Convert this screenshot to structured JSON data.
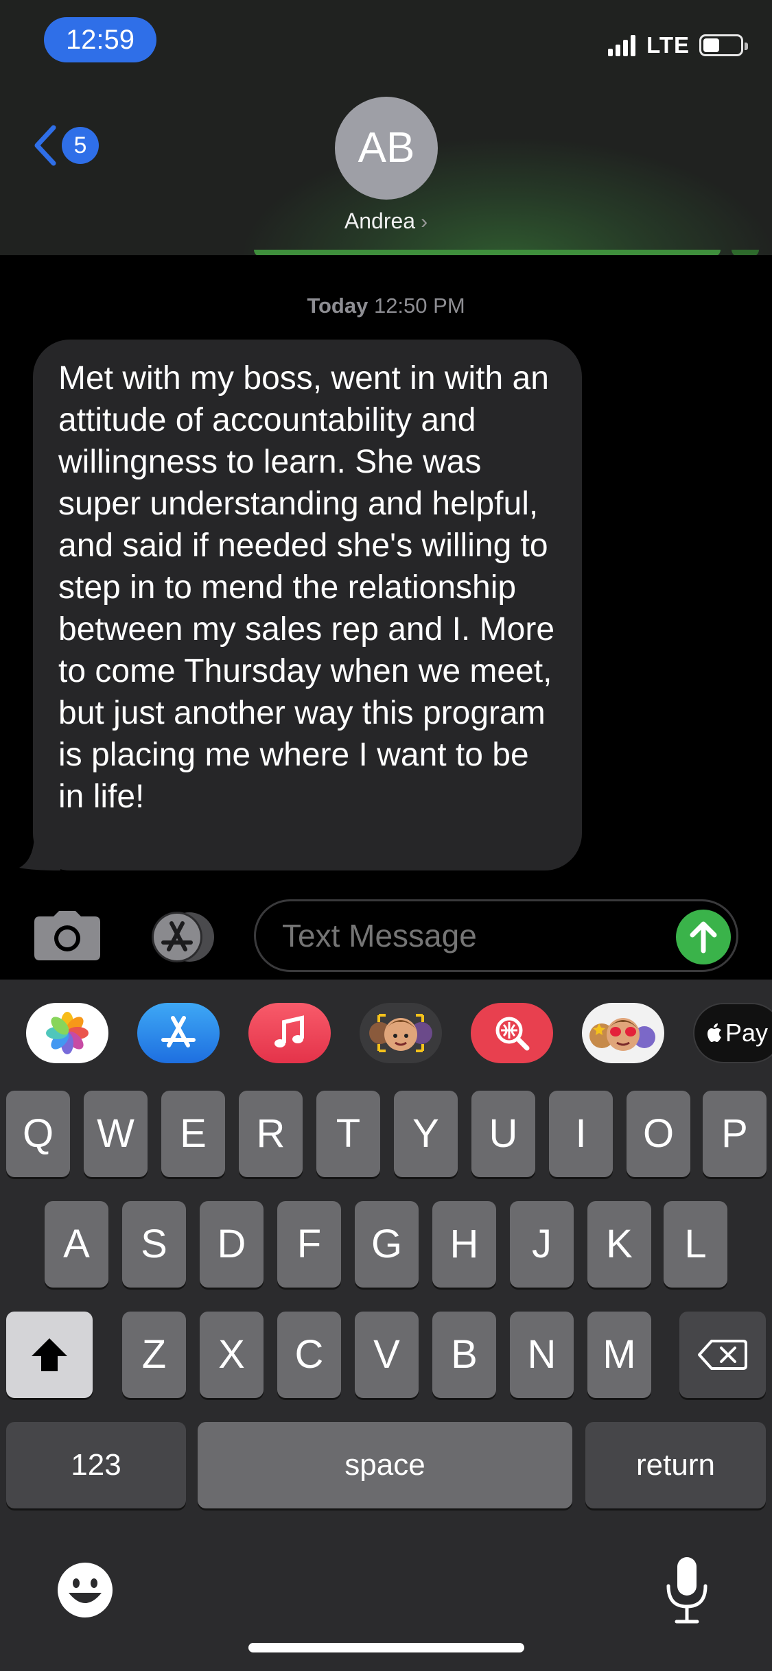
{
  "status_bar": {
    "time": "12:59",
    "network": "LTE",
    "signal_bars": 4,
    "battery_level": 0.45
  },
  "header": {
    "back_badge_count": "5",
    "avatar_initials": "AB",
    "contact_name": "Andrea",
    "contact_chevron": "›"
  },
  "conversation": {
    "timestamp_day": "Today",
    "timestamp_time": "12:50 PM",
    "messages": [
      {
        "direction": "incoming",
        "text": "Met with my boss, went in with an attitude of accountability and willingness to learn. She was super understanding and helpful, and said if needed she's willing to step in to mend the relationship between my sales rep and I. More to come Thursday when we meet, but just another way this program is placing me where I want to be in life!"
      }
    ]
  },
  "input_bar": {
    "placeholder": "Text Message",
    "value": "",
    "camera_icon": "camera-icon",
    "apps_icon": "app-store-icon",
    "send_icon": "arrow-up-icon"
  },
  "app_strip": [
    {
      "name": "photos-app-icon"
    },
    {
      "name": "app-store-icon"
    },
    {
      "name": "music-app-icon"
    },
    {
      "name": "memoji-stickers-icon"
    },
    {
      "name": "images-search-icon"
    },
    {
      "name": "animoji-icon"
    },
    {
      "name": "apple-pay-icon",
      "label": "Pay"
    }
  ],
  "keyboard": {
    "row1": [
      "Q",
      "W",
      "E",
      "R",
      "T",
      "Y",
      "U",
      "I",
      "O",
      "P"
    ],
    "row2": [
      "A",
      "S",
      "D",
      "F",
      "G",
      "H",
      "J",
      "K",
      "L"
    ],
    "row3": [
      "Z",
      "X",
      "C",
      "V",
      "B",
      "N",
      "M"
    ],
    "numbers_label": "123",
    "space_label": "space",
    "return_label": "return"
  },
  "colors": {
    "accent_blue": "#2f6fe8",
    "send_green": "#3ab34a",
    "incoming_bubble": "#262628",
    "key_background": "#6b6b6e"
  }
}
